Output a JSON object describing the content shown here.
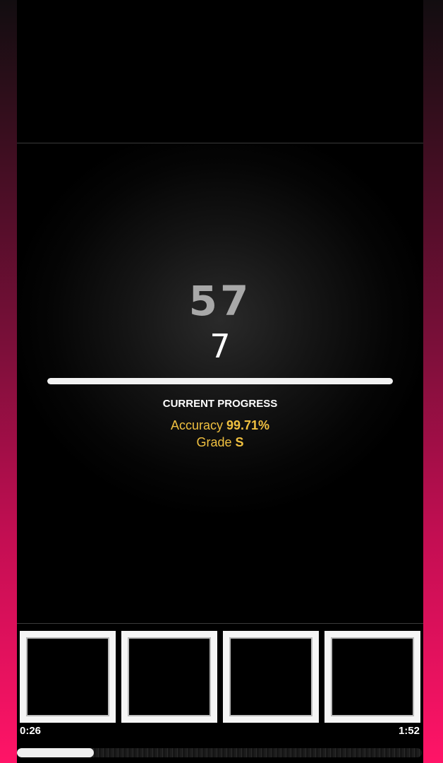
{
  "combo": {
    "count": "57",
    "digit": "7"
  },
  "progress": {
    "fraction": 1.0,
    "title": "CURRENT PROGRESS",
    "accuracy_label": "Accuracy",
    "accuracy_value": "99.71%",
    "grade_label": "Grade",
    "grade_value": "S"
  },
  "lanes": [
    "lane-1",
    "lane-2",
    "lane-3",
    "lane-4"
  ],
  "timeline": {
    "current_time": "0:26",
    "total_time": "1:52",
    "fraction": 0.19
  },
  "colors": {
    "accent_pink": "#ff1467",
    "stat_gold": "#f0c040",
    "combo_gray": "#a8a8a8"
  }
}
